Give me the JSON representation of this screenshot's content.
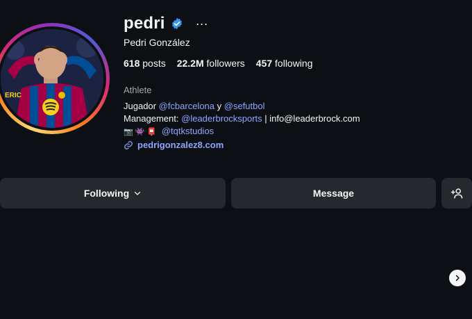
{
  "profile": {
    "username": "pedri",
    "full_name": "Pedri González",
    "verified_icon": "verified-badge-icon",
    "more_label": "···",
    "category": "Athlete"
  },
  "stats": {
    "posts_count": "618",
    "posts_label": "posts",
    "followers_count": "22.2M",
    "followers_label": "followers",
    "following_count": "457",
    "following_label": "following"
  },
  "bio": {
    "line1_prefix": "Jugador",
    "line1_mention1": "@fcbarcelona",
    "line1_mid": "y",
    "line1_mention2": "@sefutbol",
    "line2_prefix": "Management:",
    "line2_mention": "@leaderbrocksports",
    "line2_suffix": "| info@leaderbrock.com",
    "line3_emojis": "📷 👾 📮",
    "line3_mention": "@tqtkstudios",
    "link": "pedrigonzalez8.com"
  },
  "actions": {
    "following_label": "Following",
    "message_label": "Message"
  },
  "colors": {
    "background": "#0c1014",
    "button": "#25292e",
    "link": "#8ea5ff",
    "verified": "#3897f0"
  }
}
